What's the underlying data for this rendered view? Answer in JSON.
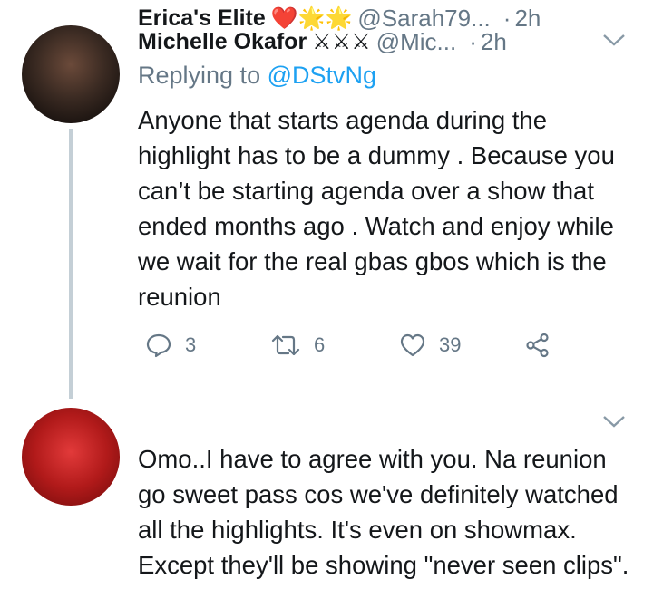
{
  "tweets": [
    {
      "name": "Michelle Okafor",
      "name_decoration": "⚔⚔⚔",
      "handle": "@Mic...",
      "separator": "·",
      "time": "2h",
      "replying_label": "Replying to",
      "replying_to": "@DStvNg",
      "text": "Anyone that starts agenda during the highlight has to be a dummy . Because you can’t be starting agenda over a show that ended months ago . Watch and enjoy while we wait for the real gbas gbos which is the reunion",
      "counts": {
        "replies": "3",
        "retweets": "6",
        "likes": "39"
      }
    },
    {
      "name": "Erica's Elite",
      "name_decoration": "❤️🌟🌟",
      "handle": "@Sarah79...",
      "separator": "·",
      "time": "2h",
      "text": "Omo..I have to agree with you. Na reunion go sweet pass cos we've definitely watched all the highlights. It's even on showmax. Except they'll be showing \"never seen clips\"."
    }
  ],
  "icons": {
    "reply": "reply-icon",
    "retweet": "retweet-icon",
    "like": "heart-icon",
    "share": "share-icon",
    "caret": "chevron-down-icon"
  },
  "colors": {
    "link": "#1da1f2",
    "secondary": "#657786",
    "thread_line": "#c4cfd6"
  }
}
